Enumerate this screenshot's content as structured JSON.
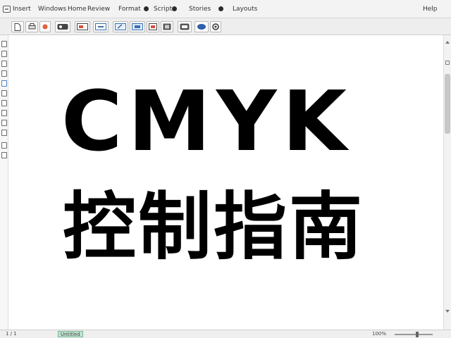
{
  "menubar": {
    "items": [
      "Insert",
      "Windows",
      "Home",
      "Review",
      "Format",
      "Scripts",
      "Stories",
      "Layouts",
      "Help"
    ]
  },
  "toolbar": {
    "buttons": [
      "new-file-icon",
      "print-icon",
      "record-icon",
      "export-icon",
      "image-icon",
      "link-icon",
      "edit-icon",
      "color-icon",
      "layers-icon",
      "book-icon",
      "toggle-icon",
      "help-icon"
    ]
  },
  "document": {
    "headline": "CMYK",
    "subline": "控制指南"
  },
  "statusbar": {
    "page": "1 / 1",
    "tab": "Untitled",
    "zoom": "100%"
  },
  "colors": {
    "text": "#000000",
    "background": "#ffffff",
    "chrome": "#f3f3f3",
    "status_tab": "#bfe3cf"
  }
}
